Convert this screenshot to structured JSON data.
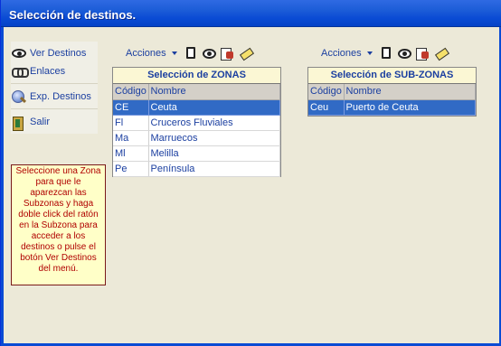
{
  "window": {
    "title": "Selección de destinos."
  },
  "menu": {
    "items": [
      {
        "label": "Ver Destinos",
        "icon": "eye-icon"
      },
      {
        "label": "Enlaces",
        "icon": "link-icon"
      },
      {
        "label": "Exp. Destinos",
        "icon": "globe-icon"
      },
      {
        "label": "Salir",
        "icon": "exit-door-icon"
      }
    ]
  },
  "info": {
    "text": "Seleccione una Zona para que le aparezcan las Subzonas y haga doble click del ratón en la Subzona para acceder a los destinos o pulse el botón Ver Destinos del menú."
  },
  "zonas": {
    "toolbar_label": "Acciones",
    "title": "Selección de ZONAS",
    "columns": [
      "Código",
      "Nombre"
    ],
    "rows": [
      {
        "codigo": "CE",
        "nombre": "Ceuta",
        "selected": true
      },
      {
        "codigo": "Fl",
        "nombre": "Cruceros Fluviales",
        "selected": false
      },
      {
        "codigo": "Ma",
        "nombre": "Marruecos",
        "selected": false
      },
      {
        "codigo": "Ml",
        "nombre": "Melilla",
        "selected": false
      },
      {
        "codigo": "Pe",
        "nombre": "Península",
        "selected": false
      }
    ]
  },
  "subzonas": {
    "toolbar_label": "Acciones",
    "title": "Selección de SUB-ZONAS",
    "columns": [
      "Código",
      "Nombre"
    ],
    "rows": [
      {
        "codigo": "Ceu",
        "nombre": "Puerto de Ceuta",
        "selected": true
      }
    ]
  },
  "colors": {
    "title_bar": "#0a4bd4",
    "link_text": "#1b3fa0",
    "selection": "#316ac5",
    "info_text": "#b00000",
    "info_bg": "#ffffc8"
  }
}
